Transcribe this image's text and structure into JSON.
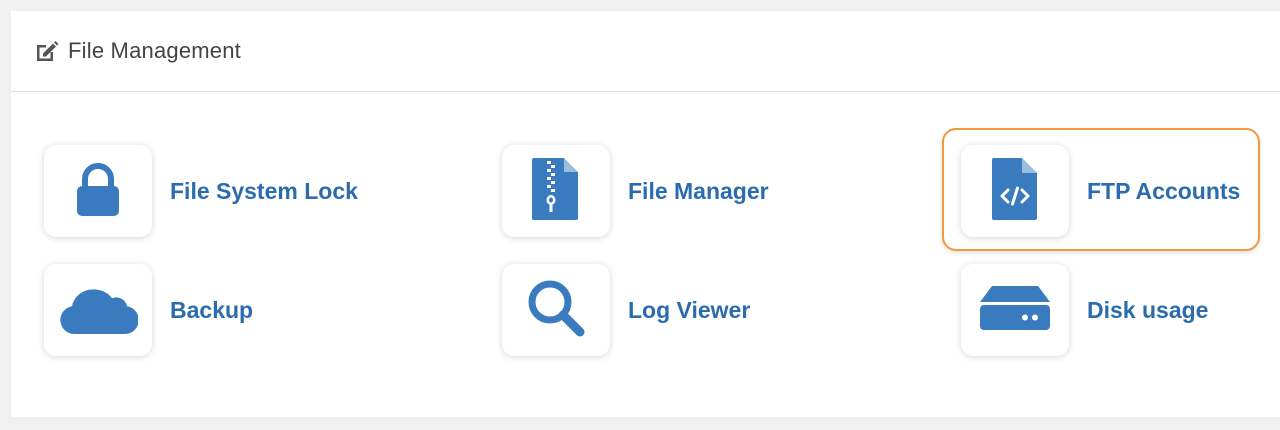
{
  "panel": {
    "title": "File Management",
    "title_icon": "edit-icon"
  },
  "tiles": [
    {
      "label": "File System Lock",
      "icon": "lock-icon"
    },
    {
      "label": "File Manager",
      "icon": "zip-file-icon"
    },
    {
      "label": "FTP Accounts",
      "icon": "code-file-icon",
      "highlighted": true
    },
    {
      "label": "Backup",
      "icon": "cloud-icon"
    },
    {
      "label": "Log Viewer",
      "icon": "search-icon"
    },
    {
      "label": "Disk usage",
      "icon": "hard-drive-icon"
    }
  ],
  "colors": {
    "accent": "#2a6cae",
    "icon": "#3a7bbf",
    "highlight_border": "#f09a3e"
  }
}
